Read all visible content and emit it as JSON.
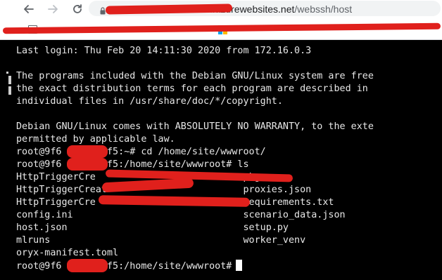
{
  "browser": {
    "url_host_suffix": "scm.azurewebsites.net",
    "url_path": "/webssh/host",
    "back_icon": "arrow-left",
    "forward_icon": "arrow-right",
    "reload_icon": "reload",
    "secure_icon": "lock"
  },
  "bookmarks": {
    "microsoft_logo_colors": [
      "#f25022",
      "#7fba00",
      "#00a4ef",
      "#ffb900"
    ]
  },
  "terminal": {
    "lines": [
      "Last login: Thu Feb 20 14:11:30 2020 from 172.16.0.3",
      "",
      "The programs included with the Debian GNU/Linux system are free",
      "the exact distribution terms for each program are described in",
      "individual files in /usr/share/doc/*/copyright.",
      "",
      "Debian GNU/Linux comes with ABSOLUTELY NO WARRANTY, to the exte",
      "permitted by applicable law.",
      "root@9f6      bff5:~# cd /home/site/wwwroot/",
      "root@9f6      bff5:/home/site/wwwroot# ls",
      "HttpTriggerCre                          pkg",
      "HttpTriggerCreat                        proxies.json",
      "HttpTriggerCre                          requirements.txt",
      "config.ini                              scenario_data.json",
      "host.json                               setup.py",
      "mlruns                                  worker_venv",
      "oryx-manifest.toml",
      "root@9f6      bff5:/home/site/wwwroot#"
    ],
    "text_color": "#e8e8e8",
    "background": "#000000",
    "redaction_color": "#e0201c"
  }
}
